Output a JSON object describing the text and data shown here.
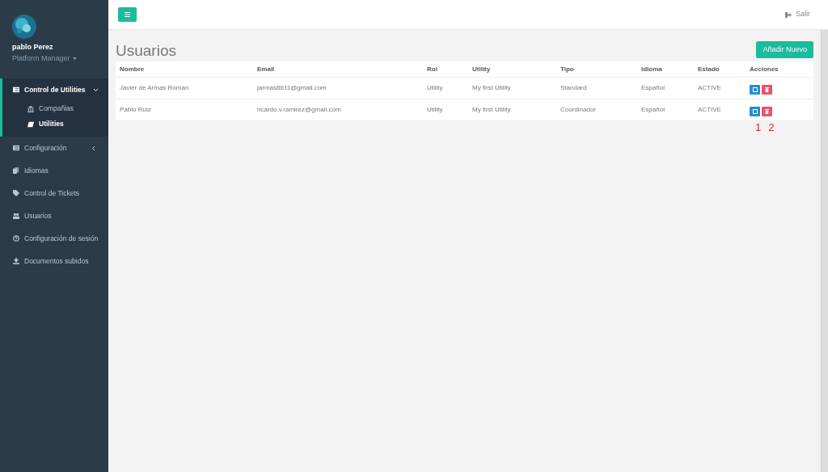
{
  "user": {
    "name": "pablo Perez",
    "role": "Platform Manager"
  },
  "nav": [
    {
      "label": "Control de Utilities",
      "expanded": true,
      "selected": true,
      "children": [
        {
          "label": "Compañias",
          "selected": false
        },
        {
          "label": "Utilities",
          "selected": true
        }
      ]
    },
    {
      "label": "Configuración",
      "expanded": false,
      "selected": false
    },
    {
      "label": "Idiomas",
      "selected": false
    },
    {
      "label": "Control de Tickets",
      "selected": false
    },
    {
      "label": "Usuarios",
      "selected": false
    },
    {
      "label": "Configuración de sesión",
      "selected": false
    },
    {
      "label": "Documentos subidos",
      "selected": false
    }
  ],
  "topbar": {
    "logout": "Salir"
  },
  "page": {
    "title": "Usuarios",
    "add_button": "Añadir Nuevo"
  },
  "table": {
    "columns": [
      "Nombre",
      "Email",
      "Rol",
      "Utility",
      "Tipo",
      "Idioma",
      "Estado",
      "Acciones"
    ],
    "rows": [
      [
        "Javier de Armas Roman",
        "jarmas8611@gmail.com",
        "Utility",
        "My first Utility",
        "Standard",
        "Español",
        "ACTIVE"
      ],
      [
        "Pablo Ruiz",
        "ricardo.v.ramirez@gmail.com",
        "Utility",
        "My first Utility",
        "Coordinador",
        "Español",
        "ACTIVE"
      ]
    ]
  },
  "annotations": [
    "1",
    "2"
  ]
}
